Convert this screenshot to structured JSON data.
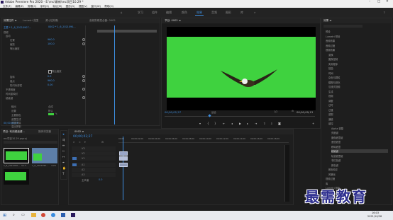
{
  "app": {
    "title": "Adobe Premiere Pro 2020 - E:\\mc\\最新\\mc项目10.29 *"
  },
  "menu": [
    "文件(F)",
    "编辑(E)",
    "剪辑(C)",
    "序列(S)",
    "标记(M)",
    "图形(G)",
    "视图(V)",
    "窗口(W)",
    "帮助(H)"
  ],
  "workspaces": {
    "items": [
      "学习",
      "组件",
      "编辑",
      "颜色",
      "效果",
      "音频",
      "图形",
      "库"
    ],
    "active_index": 4
  },
  "effect_controls": {
    "tabs": [
      "效果控件 ≡",
      "Lumetri 范围",
      "源:(无剪辑)",
      "音频剪辑混合器: 0002"
    ],
    "source_line": "主要 * 1_6_20210907...",
    "clip_line": "0002 * 1_6_2021090...",
    "sections": [
      "视频",
      "运动",
      "位置",
      "缩放",
      "等比缩放",
      "旋转",
      "锚点",
      "防闪烁滤镜",
      "不透明度",
      "时间重映射",
      "超级键",
      "输出",
      "设置",
      "主要颜色",
      "遮罩生成",
      "遮罩清除",
      "溢出抑制",
      "颜色校正"
    ],
    "values": [
      "960.0",
      "100.0",
      "0.0",
      "960.0",
      "0.00",
      "合成",
      "默认"
    ],
    "checkbox_label": "等比缩放",
    "timecode": "00;00;02;27"
  },
  "program": {
    "tab": "节目: 0002 ≡",
    "timecode_left": "00;00;02;27",
    "timecode_right": "00;00;09;13",
    "fit": "适合",
    "ratio": "1/2"
  },
  "project": {
    "tabs": [
      "项目: 利用超级键...",
      "效果",
      "媒体浏览器"
    ],
    "file": "mc项目10.29.prproj",
    "clips": [
      "1_6_2021090...",
      "1_6_2021090..."
    ],
    "durations": [
      "9;13",
      "4;20"
    ]
  },
  "timeline": {
    "tab": "0002 ≡",
    "timecode": "00;00;02;27",
    "ruler": [
      "00;00",
      "00;00;02;00",
      "00;00;04;00",
      "00;00;06;00",
      "00;00;08;00",
      "00;00;10;00",
      "00;00;12;00",
      "00;00;14;00",
      "00;00;16;00",
      "00;00;18;00"
    ],
    "tracks": [
      "V3",
      "V2",
      "V1",
      "A1",
      "A2",
      "A3"
    ],
    "master": "主声道",
    "master_val": "0.0"
  },
  "effects_panel": {
    "tab": "效果 ≡",
    "folders": [
      "预设",
      "Lumetri 预设",
      "音频效果",
      "音频过渡",
      "视频效果",
      "变换",
      "图像控制",
      "实用程序",
      "扭曲",
      "时间",
      "杂色与颗粒",
      "模糊与锐化",
      "沉浸式视频",
      "生成",
      "视频",
      "调整",
      "过时",
      "过渡",
      "透视",
      "通道",
      "键控",
      "Alpha 调整",
      "亮度键",
      "图像遮罩键",
      "差值遮罩",
      "移除遮罩",
      "超级键",
      "轨道遮罩键",
      "非红色键",
      "颜色键",
      "颜色校正",
      "风格化",
      "视频过渡",
      "库",
      "Lumetri 颜色"
    ],
    "selected": "超级键"
  },
  "watermark": "最需教育",
  "taskbar": {
    "time": "16:03",
    "date": "2021/10/28"
  }
}
